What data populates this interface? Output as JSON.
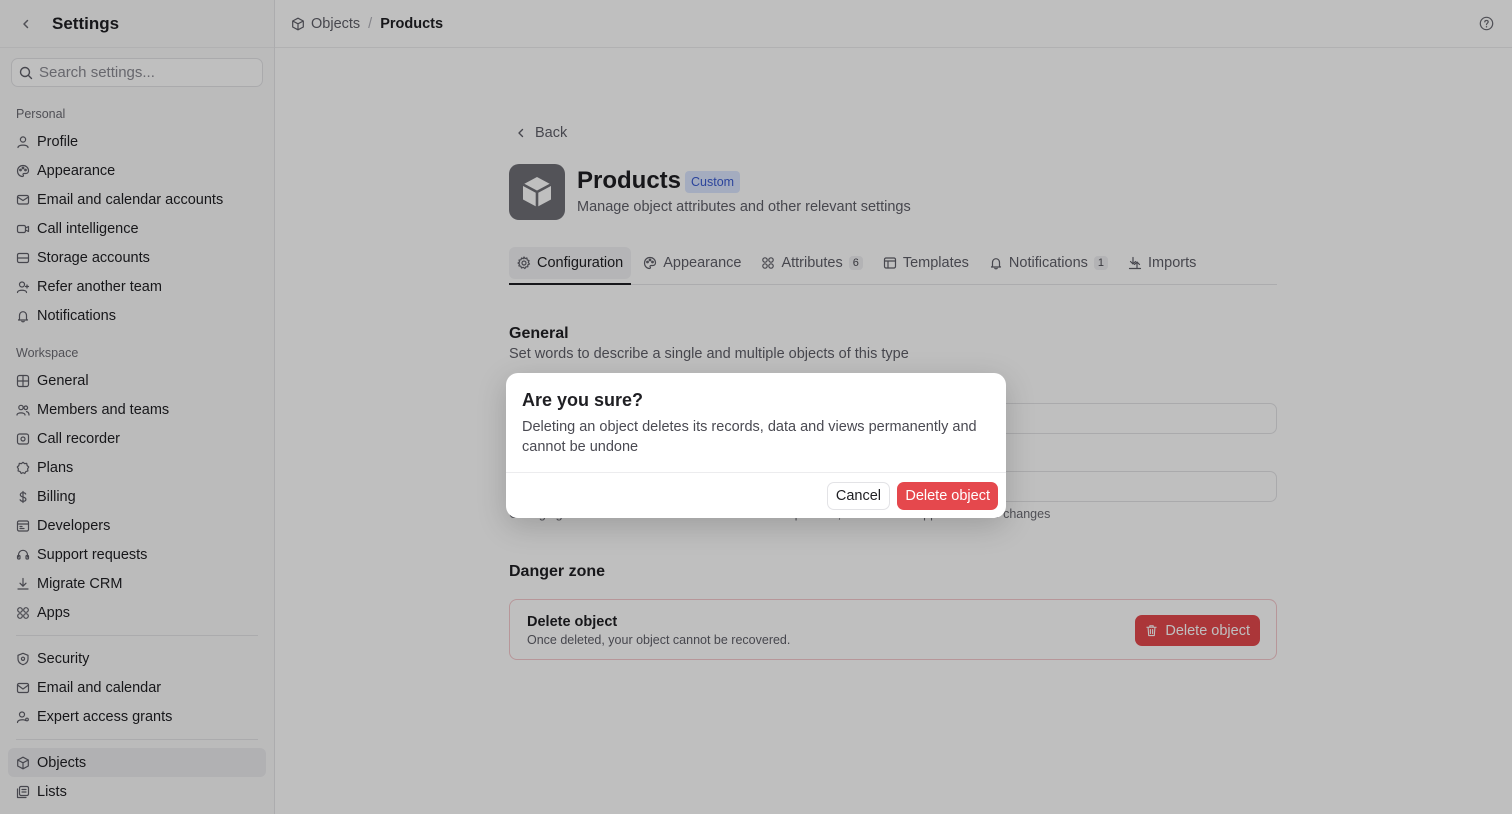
{
  "sidebar": {
    "title": "Settings",
    "search_placeholder": "Search settings...",
    "personal_label": "Personal",
    "workspace_label": "Workspace",
    "personal_items": [
      {
        "label": "Profile",
        "icon": "user-icon"
      },
      {
        "label": "Appearance",
        "icon": "palette-icon"
      },
      {
        "label": "Email and calendar accounts",
        "icon": "mail-calendar-icon"
      },
      {
        "label": "Call intelligence",
        "icon": "video-icon"
      },
      {
        "label": "Storage accounts",
        "icon": "storage-icon"
      },
      {
        "label": "Refer another team",
        "icon": "user-plus-icon"
      },
      {
        "label": "Notifications",
        "icon": "bell-icon"
      }
    ],
    "workspace_items": [
      {
        "label": "General",
        "icon": "grid-icon"
      },
      {
        "label": "Members and teams",
        "icon": "users-icon"
      },
      {
        "label": "Call recorder",
        "icon": "record-icon"
      },
      {
        "label": "Plans",
        "icon": "badge-icon"
      },
      {
        "label": "Billing",
        "icon": "dollar-icon"
      },
      {
        "label": "Developers",
        "icon": "code-icon"
      },
      {
        "label": "Support requests",
        "icon": "headset-icon"
      },
      {
        "label": "Migrate CRM",
        "icon": "download-icon"
      },
      {
        "label": "Apps",
        "icon": "apps-icon"
      }
    ],
    "security_items": [
      {
        "label": "Security",
        "icon": "shield-icon"
      },
      {
        "label": "Email and calendar",
        "icon": "envelope-icon"
      },
      {
        "label": "Expert access grants",
        "icon": "user-key-icon"
      }
    ],
    "data_items": [
      {
        "label": "Objects",
        "icon": "cube-icon",
        "active": true
      },
      {
        "label": "Lists",
        "icon": "list-icon"
      }
    ]
  },
  "topbar": {
    "crumb_1": "Objects",
    "crumb_2": "Products"
  },
  "main": {
    "back_label": "Back",
    "title": "Products",
    "badge": "Custom",
    "subtitle": "Manage object attributes and other relevant settings",
    "tabs": [
      {
        "label": "Configuration",
        "icon": "gear-icon",
        "active": true
      },
      {
        "label": "Appearance",
        "icon": "palette-icon"
      },
      {
        "label": "Attributes",
        "icon": "attributes-icon",
        "count": "6"
      },
      {
        "label": "Templates",
        "icon": "template-icon"
      },
      {
        "label": "Notifications",
        "icon": "bell-icon",
        "count": "1"
      },
      {
        "label": "Imports",
        "icon": "import-icon"
      }
    ],
    "general_title": "General",
    "general_desc": "Set words to describe a single and multiple objects of this type",
    "identifier_hint": "Changing the identifier can have unintended consequences, contact our support to make changes",
    "danger_title": "Danger zone",
    "danger_item_title": "Delete object",
    "danger_item_desc": "Once deleted, your object cannot be recovered.",
    "danger_button": "Delete object"
  },
  "dialog": {
    "title": "Are you sure?",
    "message": "Deleting an object deletes its records, data and views permanently and cannot be undone",
    "cancel_label": "Cancel",
    "confirm_label": "Delete object"
  },
  "colors": {
    "danger": "#e5484d",
    "badge_bg": "#dbe6ff",
    "badge_text": "#3a5bd0"
  }
}
